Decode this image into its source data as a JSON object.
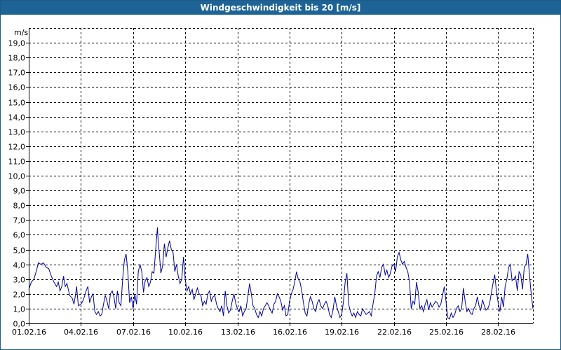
{
  "window": {
    "title": "Windgeschwindigkeit bis 20 [m/s]"
  },
  "chart_data": {
    "type": "line",
    "title": "Windgeschwindigkeit bis 20 [m/s]",
    "ylabel": "m/s",
    "xlabel": "",
    "ylim": [
      0,
      20
    ],
    "xlim": [
      0,
      29
    ],
    "grid": true,
    "line_color": "#0000a0",
    "grid_color": "#000000",
    "y_ticks": [
      "0,0",
      "1,0",
      "2,0",
      "3,0",
      "4,0",
      "5,0",
      "6,0",
      "7,0",
      "8,0",
      "9,0",
      "10,0",
      "11,0",
      "12,0",
      "13,0",
      "14,0",
      "15,0",
      "16,0",
      "17,0",
      "18,0",
      "19,0"
    ],
    "x_ticks": [
      {
        "value": 0,
        "label": "01.02.16"
      },
      {
        "value": 3,
        "label": "04.02.16"
      },
      {
        "value": 6,
        "label": "07.02.16"
      },
      {
        "value": 9,
        "label": "10.02.16"
      },
      {
        "value": 12,
        "label": "13.02.16"
      },
      {
        "value": 15,
        "label": "16.02.16"
      },
      {
        "value": 18,
        "label": "19.02.16"
      },
      {
        "value": 21,
        "label": "22.02.16"
      },
      {
        "value": 24,
        "label": "25.02.16"
      },
      {
        "value": 27,
        "label": "28.02.16"
      }
    ],
    "series": [
      {
        "points": [
          [
            0.0,
            2.3
          ],
          [
            0.15,
            2.8
          ],
          [
            0.3,
            3.0
          ],
          [
            0.45,
            3.6
          ],
          [
            0.55,
            4.1
          ],
          [
            0.7,
            4.0
          ],
          [
            0.85,
            4.1
          ],
          [
            1.0,
            3.8
          ],
          [
            1.15,
            3.7
          ],
          [
            1.3,
            3.2
          ],
          [
            1.45,
            2.8
          ],
          [
            1.6,
            2.5
          ],
          [
            1.7,
            2.8
          ],
          [
            1.8,
            2.2
          ],
          [
            1.9,
            2.5
          ],
          [
            2.0,
            3.2
          ],
          [
            2.1,
            2.5
          ],
          [
            2.2,
            2.7
          ],
          [
            2.35,
            1.9
          ],
          [
            2.5,
            1.7
          ],
          [
            2.6,
            1.3
          ],
          [
            2.7,
            2.0
          ],
          [
            2.75,
            2.5
          ],
          [
            2.85,
            1.2
          ],
          [
            3.0,
            1.3
          ],
          [
            3.1,
            1.5
          ],
          [
            3.2,
            1.8
          ],
          [
            3.3,
            2.2
          ],
          [
            3.4,
            2.5
          ],
          [
            3.5,
            1.4
          ],
          [
            3.6,
            1.8
          ],
          [
            3.7,
            2.0
          ],
          [
            3.8,
            0.8
          ],
          [
            3.9,
            0.6
          ],
          [
            4.0,
            0.8
          ],
          [
            4.1,
            0.5
          ],
          [
            4.2,
            0.6
          ],
          [
            4.3,
            1.3
          ],
          [
            4.4,
            1.9
          ],
          [
            4.5,
            1.5
          ],
          [
            4.6,
            1.0
          ],
          [
            4.7,
            2.0
          ],
          [
            4.8,
            2.2
          ],
          [
            4.9,
            1.8
          ],
          [
            5.0,
            1.0
          ],
          [
            5.1,
            2.2
          ],
          [
            5.2,
            1.4
          ],
          [
            5.3,
            1.2
          ],
          [
            5.4,
            3.0
          ],
          [
            5.5,
            4.3
          ],
          [
            5.6,
            4.7
          ],
          [
            5.7,
            3.5
          ],
          [
            5.8,
            1.4
          ],
          [
            5.9,
            1.8
          ],
          [
            6.0,
            1.0
          ],
          [
            6.1,
            2.0
          ],
          [
            6.2,
            1.3
          ],
          [
            6.3,
            3.5
          ],
          [
            6.4,
            4.0
          ],
          [
            6.5,
            3.5
          ],
          [
            6.6,
            2.1
          ],
          [
            6.7,
            2.9
          ],
          [
            6.8,
            3.1
          ],
          [
            6.9,
            2.5
          ],
          [
            7.0,
            2.8
          ],
          [
            7.1,
            3.5
          ],
          [
            7.2,
            3.4
          ],
          [
            7.3,
            5.0
          ],
          [
            7.4,
            6.5
          ],
          [
            7.45,
            5.4
          ],
          [
            7.5,
            4.9
          ],
          [
            7.6,
            3.4
          ],
          [
            7.7,
            3.9
          ],
          [
            7.8,
            5.4
          ],
          [
            7.9,
            4.5
          ],
          [
            8.0,
            5.1
          ],
          [
            8.1,
            5.6
          ],
          [
            8.2,
            5.0
          ],
          [
            8.3,
            4.8
          ],
          [
            8.4,
            3.5
          ],
          [
            8.5,
            4.0
          ],
          [
            8.6,
            3.2
          ],
          [
            8.7,
            2.7
          ],
          [
            8.8,
            3.0
          ],
          [
            8.9,
            4.5
          ],
          [
            9.0,
            3.0
          ],
          [
            9.1,
            2.2
          ],
          [
            9.2,
            2.5
          ],
          [
            9.3,
            2.0
          ],
          [
            9.4,
            2.3
          ],
          [
            9.5,
            1.6
          ],
          [
            9.6,
            2.0
          ],
          [
            9.7,
            2.4
          ],
          [
            9.8,
            2.0
          ],
          [
            9.9,
            1.9
          ],
          [
            10.0,
            1.2
          ],
          [
            10.1,
            1.5
          ],
          [
            10.2,
            1.3
          ],
          [
            10.3,
            2.0
          ],
          [
            10.4,
            2.2
          ],
          [
            10.5,
            1.5
          ],
          [
            10.6,
            1.8
          ],
          [
            10.7,
            1.9
          ],
          [
            10.8,
            1.3
          ],
          [
            10.9,
            1.0
          ],
          [
            11.0,
            0.8
          ],
          [
            11.1,
            1.2
          ],
          [
            11.2,
            0.5
          ],
          [
            11.3,
            2.2
          ],
          [
            11.4,
            1.2
          ],
          [
            11.5,
            0.7
          ],
          [
            11.6,
            0.9
          ],
          [
            11.7,
            1.5
          ],
          [
            11.8,
            2.0
          ],
          [
            11.9,
            1.4
          ],
          [
            12.0,
            1.0
          ],
          [
            12.1,
            0.8
          ],
          [
            12.2,
            1.2
          ],
          [
            12.3,
            0.5
          ],
          [
            12.4,
            0.8
          ],
          [
            12.5,
            1.0
          ],
          [
            12.6,
            1.8
          ],
          [
            12.7,
            2.7
          ],
          [
            12.8,
            2.0
          ],
          [
            12.9,
            1.2
          ],
          [
            13.0,
            1.0
          ],
          [
            13.1,
            0.6
          ],
          [
            13.2,
            0.4
          ],
          [
            13.3,
            0.8
          ],
          [
            13.4,
            0.5
          ],
          [
            13.5,
            1.0
          ],
          [
            13.6,
            1.2
          ],
          [
            13.7,
            1.4
          ],
          [
            13.8,
            1.2
          ],
          [
            13.9,
            0.9
          ],
          [
            14.0,
            0.7
          ],
          [
            14.1,
            1.3
          ],
          [
            14.2,
            1.5
          ],
          [
            14.3,
            2.0
          ],
          [
            14.4,
            1.8
          ],
          [
            14.5,
            1.5
          ],
          [
            14.6,
            0.9
          ],
          [
            14.7,
            1.2
          ],
          [
            14.8,
            0.5
          ],
          [
            14.9,
            0.6
          ],
          [
            15.0,
            1.5
          ],
          [
            15.1,
            2.0
          ],
          [
            15.2,
            2.3
          ],
          [
            15.3,
            2.8
          ],
          [
            15.4,
            3.5
          ],
          [
            15.5,
            3.0
          ],
          [
            15.6,
            2.8
          ],
          [
            15.7,
            2.2
          ],
          [
            15.8,
            1.4
          ],
          [
            15.9,
            0.7
          ],
          [
            16.0,
            0.5
          ],
          [
            16.1,
            1.3
          ],
          [
            16.2,
            1.8
          ],
          [
            16.3,
            1.5
          ],
          [
            16.4,
            1.0
          ],
          [
            16.5,
            0.8
          ],
          [
            16.6,
            1.4
          ],
          [
            16.7,
            1.6
          ],
          [
            16.8,
            1.2
          ],
          [
            16.9,
            1.0
          ],
          [
            17.0,
            1.3
          ],
          [
            17.1,
            1.5
          ],
          [
            17.2,
            1.2
          ],
          [
            17.3,
            0.6
          ],
          [
            17.4,
            0.4
          ],
          [
            17.5,
            0.9
          ],
          [
            17.6,
            1.8
          ],
          [
            17.7,
            1.2
          ],
          [
            17.8,
            0.8
          ],
          [
            17.9,
            0.4
          ],
          [
            18.0,
            0.6
          ],
          [
            18.1,
            1.5
          ],
          [
            18.2,
            2.8
          ],
          [
            18.3,
            3.4
          ],
          [
            18.4,
            1.3
          ],
          [
            18.5,
            0.8
          ],
          [
            18.6,
            0.5
          ],
          [
            18.7,
            0.7
          ],
          [
            18.8,
            0.4
          ],
          [
            18.9,
            0.8
          ],
          [
            19.0,
            0.6
          ],
          [
            19.1,
            0.5
          ],
          [
            19.2,
            1.0
          ],
          [
            19.3,
            0.8
          ],
          [
            19.4,
            0.6
          ],
          [
            19.5,
            0.7
          ],
          [
            19.6,
            0.8
          ],
          [
            19.7,
            0.5
          ],
          [
            19.8,
            1.3
          ],
          [
            19.9,
            2.0
          ],
          [
            20.0,
            3.2
          ],
          [
            20.1,
            3.5
          ],
          [
            20.2,
            3.1
          ],
          [
            20.3,
            3.8
          ],
          [
            20.4,
            4.0
          ],
          [
            20.5,
            3.3
          ],
          [
            20.6,
            3.6
          ],
          [
            20.7,
            3.1
          ],
          [
            20.8,
            3.4
          ],
          [
            20.9,
            3.9
          ],
          [
            21.0,
            4.0
          ],
          [
            21.1,
            3.5
          ],
          [
            21.2,
            4.5
          ],
          [
            21.3,
            4.8
          ],
          [
            21.4,
            4.3
          ],
          [
            21.5,
            4.0
          ],
          [
            21.6,
            4.2
          ],
          [
            21.7,
            3.8
          ],
          [
            21.8,
            3.5
          ],
          [
            21.9,
            2.8
          ],
          [
            22.0,
            1.0
          ],
          [
            22.1,
            1.5
          ],
          [
            22.2,
            1.3
          ],
          [
            22.3,
            2.8
          ],
          [
            22.4,
            2.1
          ],
          [
            22.5,
            1.0
          ],
          [
            22.6,
            1.2
          ],
          [
            22.7,
            0.8
          ],
          [
            22.8,
            1.3
          ],
          [
            22.9,
            1.6
          ],
          [
            23.0,
            0.9
          ],
          [
            23.1,
            1.4
          ],
          [
            23.2,
            1.1
          ],
          [
            23.3,
            1.3
          ],
          [
            23.4,
            1.5
          ],
          [
            23.5,
            1.4
          ],
          [
            23.6,
            1.1
          ],
          [
            23.7,
            1.3
          ],
          [
            23.8,
            1.9
          ],
          [
            23.9,
            2.5
          ],
          [
            24.0,
            1.5
          ],
          [
            24.1,
            0.4
          ],
          [
            24.2,
            0.3
          ],
          [
            24.3,
            0.7
          ],
          [
            24.4,
            0.4
          ],
          [
            24.5,
            0.6
          ],
          [
            24.6,
            1.0
          ],
          [
            24.7,
            1.2
          ],
          [
            24.8,
            0.8
          ],
          [
            24.9,
            1.0
          ],
          [
            25.0,
            2.4
          ],
          [
            25.1,
            1.5
          ],
          [
            25.2,
            0.8
          ],
          [
            25.3,
            1.0
          ],
          [
            25.4,
            0.7
          ],
          [
            25.5,
            0.6
          ],
          [
            25.6,
            1.0
          ],
          [
            25.7,
            1.2
          ],
          [
            25.8,
            1.8
          ],
          [
            25.9,
            1.2
          ],
          [
            26.0,
            0.9
          ],
          [
            26.1,
            1.6
          ],
          [
            26.2,
            1.2
          ],
          [
            26.3,
            0.9
          ],
          [
            26.4,
            1.0
          ],
          [
            26.5,
            1.3
          ],
          [
            26.6,
            2.0
          ],
          [
            26.7,
            2.7
          ],
          [
            26.8,
            3.3
          ],
          [
            26.9,
            2.2
          ],
          [
            27.0,
            1.4
          ],
          [
            27.1,
            0.8
          ],
          [
            27.2,
            1.8
          ],
          [
            27.3,
            1.1
          ],
          [
            27.4,
            2.5
          ],
          [
            27.5,
            3.0
          ],
          [
            27.6,
            3.8
          ],
          [
            27.7,
            4.0
          ],
          [
            27.8,
            2.9
          ],
          [
            27.9,
            3.0
          ],
          [
            28.0,
            3.2
          ],
          [
            28.1,
            2.2
          ],
          [
            28.2,
            3.5
          ],
          [
            28.3,
            3.3
          ],
          [
            28.4,
            2.3
          ],
          [
            28.5,
            3.8
          ],
          [
            28.6,
            4.0
          ],
          [
            28.7,
            4.7
          ],
          [
            28.8,
            3.3
          ],
          [
            28.9,
            2.0
          ],
          [
            29.0,
            1.0
          ]
        ]
      }
    ]
  }
}
